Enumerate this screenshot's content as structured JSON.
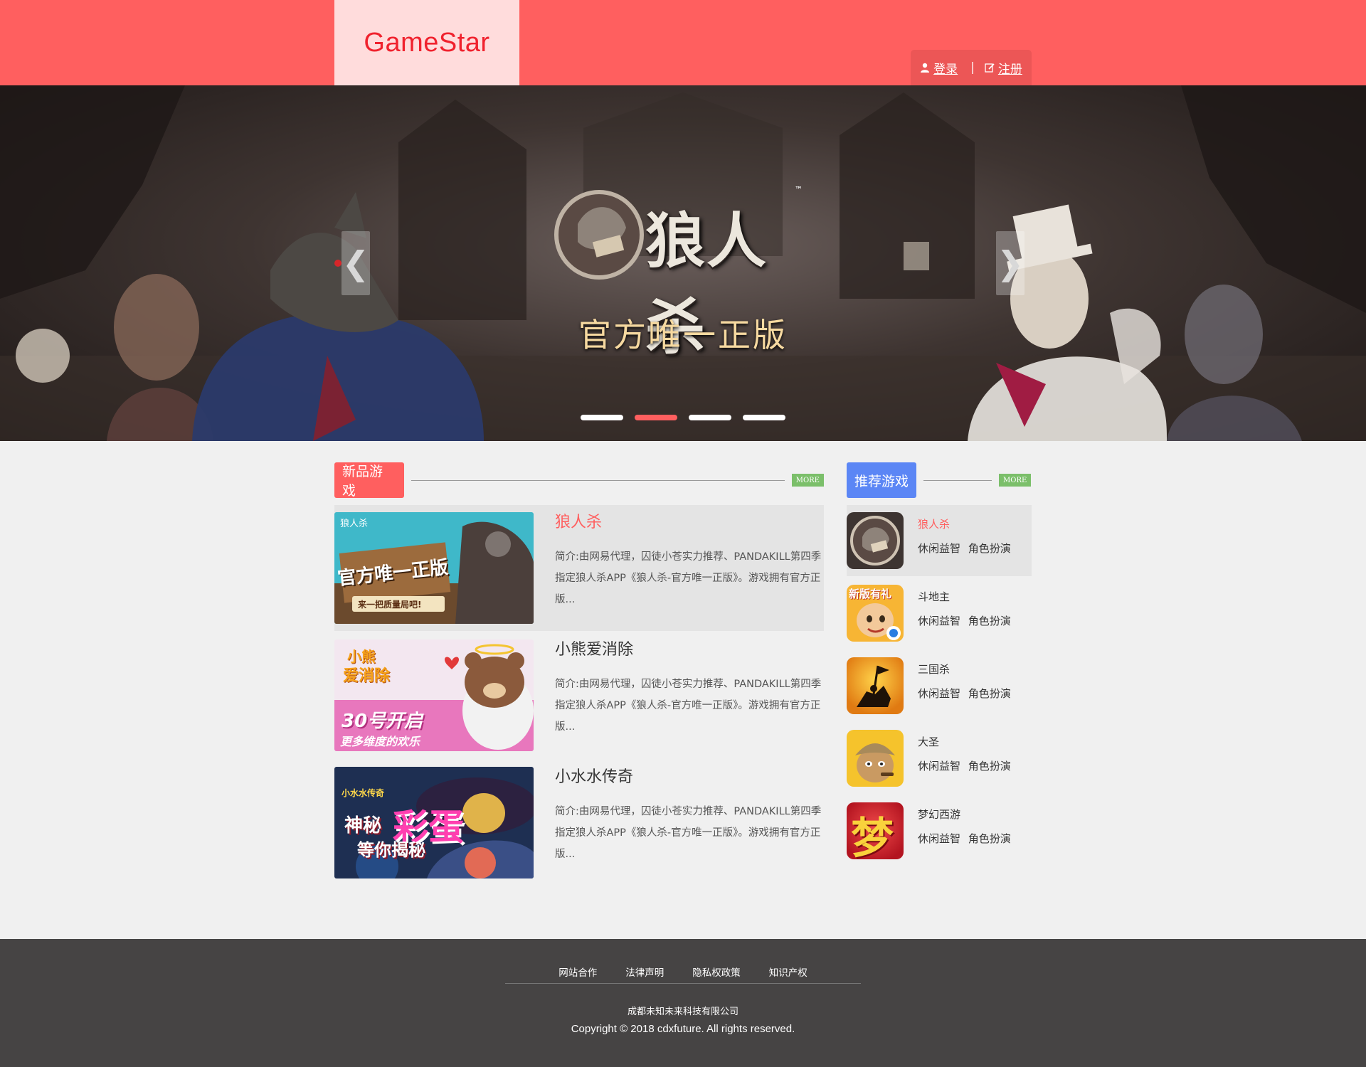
{
  "header": {
    "logo": "GameStar",
    "login_label": "登录",
    "register_label": "注册",
    "separator": "|"
  },
  "banner": {
    "game_name": "狼人杀",
    "trademark": "™",
    "slogan": "官方唯一正版",
    "prev_label": "❮",
    "next_label": "❯",
    "slide_count": 4,
    "active_slide": 2
  },
  "new_games": {
    "title": "新品游戏",
    "more_label": "MORE",
    "items": [
      {
        "title": "狼人杀",
        "desc": "简介:由网易代理，囚徒小苍实力推荐、PANDAKILL第四季指定狼人杀APP《狼人杀-官方唯一正版》。游戏拥有官方正版...",
        "thumb_text": [
          "狼人杀",
          "官方唯一正版",
          "来一把质量局吧!"
        ]
      },
      {
        "title": "小熊爱消除",
        "desc": "简介:由网易代理，囚徒小苍实力推荐、PANDAKILL第四季指定狼人杀APP《狼人杀-官方唯一正版》。游戏拥有官方正版...",
        "thumb_text": [
          "小熊",
          "爱消除",
          "30号开启",
          "更多维度的欢乐"
        ]
      },
      {
        "title": "小水水传奇",
        "desc": "简介:由网易代理，囚徒小苍实力推荐、PANDAKILL第四季指定狼人杀APP《狼人杀-官方唯一正版》。游戏拥有官方正版...",
        "thumb_text": [
          "小水水传奇",
          "神秘",
          "彩蛋",
          "等你揭秘"
        ]
      }
    ]
  },
  "recommended": {
    "title": "推荐游戏",
    "more_label": "MORE",
    "items": [
      {
        "name": "狼人杀",
        "tags": "休闲益智 角色扮演"
      },
      {
        "name": "斗地主",
        "tags": "休闲益智 角色扮演",
        "icon_text": "新版有礼"
      },
      {
        "name": "三国杀",
        "tags": "休闲益智 角色扮演"
      },
      {
        "name": "大圣",
        "tags": "休闲益智 角色扮演"
      },
      {
        "name": "梦幻西游",
        "tags": "休闲益智 角色扮演",
        "icon_text": "梦"
      }
    ]
  },
  "footer": {
    "links": [
      "网站合作",
      "法律声明",
      "隐私权政策",
      "知识产权"
    ],
    "company": "成都未知未来科技有限公司",
    "copyright": "Copyright © 2018 cdxfuture. All rights reserved."
  },
  "colors": {
    "brand_red": "#ff5f5f",
    "logo_bg": "#ffdcdc",
    "recommend_blue": "#5b86f5",
    "more_green": "#7bbf6a",
    "footer_bg": "#464444",
    "slogan_gold": "#f6d9a0"
  },
  "icons": {
    "login": "user-icon",
    "register": "edit-icon"
  }
}
